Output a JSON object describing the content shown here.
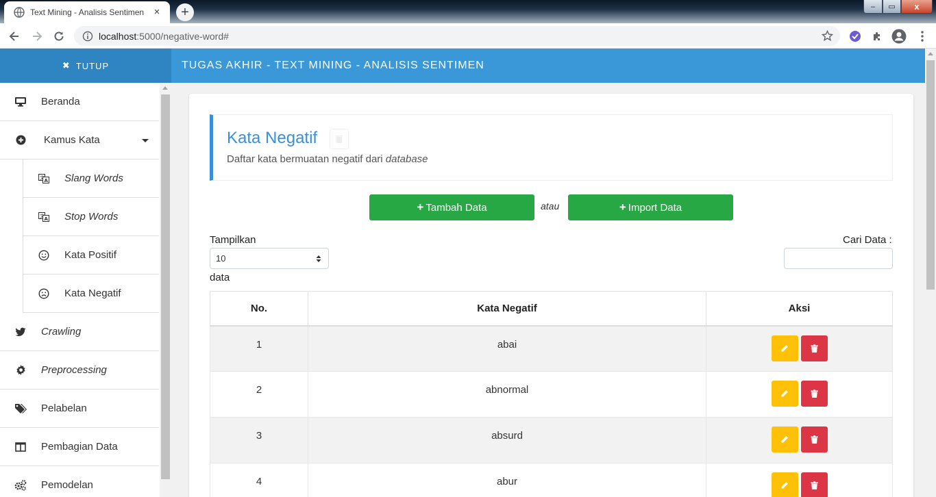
{
  "browser": {
    "tab_title": "Text Mining - Analisis Sentimen",
    "tab_close": "×",
    "new_tab": "+",
    "url_host": "localhost",
    "url_rest": ":5000/negative-word#",
    "win_min": "–",
    "win_max": "▭",
    "win_close": "x"
  },
  "header": {
    "close_label": "TUTUP",
    "close_icon": "✖",
    "title": "TUGAS AKHIR - TEXT MINING - ANALISIS SENTIMEN"
  },
  "sidebar": {
    "items": [
      {
        "label": "Beranda",
        "icon": "desktop-icon"
      },
      {
        "label": "Kamus Kata",
        "icon": "plus-circle-icon"
      },
      {
        "label": "Slang Words",
        "icon": "translate-icon"
      },
      {
        "label": "Stop Words",
        "icon": "translate-icon"
      },
      {
        "label": "Kata Positif",
        "icon": "smile-icon"
      },
      {
        "label": "Kata Negatif",
        "icon": "frown-icon"
      },
      {
        "label": "Crawling",
        "icon": "twitter-icon"
      },
      {
        "label": "Preprocessing",
        "icon": "gear-icon"
      },
      {
        "label": "Pelabelan",
        "icon": "tags-icon"
      },
      {
        "label": "Pembagian Data",
        "icon": "columns-icon"
      },
      {
        "label": "Pemodelan",
        "icon": "cogs-icon"
      }
    ]
  },
  "page": {
    "title": "Kata Negatif",
    "subtitle_text": "Daftar kata bermuatan negatif dari ",
    "subtitle_em": "database",
    "add_label": "Tambah Data",
    "or_label": "atau",
    "import_label": "Import Data",
    "plus": "+",
    "show_label": "Tampilkan",
    "show_value": "10",
    "data_label": "data",
    "search_label": "Cari Data :"
  },
  "table": {
    "headers": [
      "No.",
      "Kata Negatif",
      "Aksi"
    ],
    "rows": [
      {
        "no": "1",
        "word": "abai"
      },
      {
        "no": "2",
        "word": "abnormal"
      },
      {
        "no": "3",
        "word": "absurd"
      },
      {
        "no": "4",
        "word": "abur"
      }
    ]
  },
  "colors": {
    "header_blue": "#3a98d8",
    "accent_blue": "#3a8fd8",
    "green": "#28a745",
    "edit_yellow": "#ffc107",
    "delete_red": "#dc3545"
  }
}
